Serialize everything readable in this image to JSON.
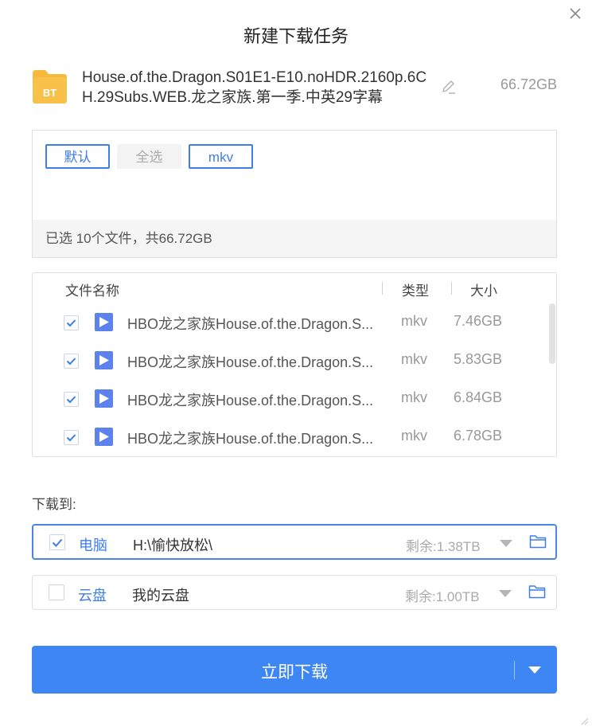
{
  "dialog": {
    "title": "新建下载任务",
    "close_icon": "close-icon"
  },
  "torrent": {
    "icon_label": "BT",
    "name": "House.of.the.Dragon.S01E1-E10.noHDR.2160p.6CH.29Subs.WEB.龙之家族.第一季.中英29字幕",
    "size": "66.72GB",
    "icon_color": "#f6b93b"
  },
  "filters": {
    "buttons": [
      {
        "label": "默认",
        "active": true
      },
      {
        "label": "全选",
        "active": false
      },
      {
        "label": "mkv",
        "active": true
      }
    ],
    "summary": "已选 10个文件，共66.72GB"
  },
  "file_list": {
    "headers": {
      "name": "文件名称",
      "type": "类型",
      "size": "大小"
    },
    "rows": [
      {
        "name": "HBO龙之家族House.of.the.Dragon.S...",
        "type": "mkv",
        "size": "7.46GB",
        "checked": true
      },
      {
        "name": "HBO龙之家族House.of.the.Dragon.S...",
        "type": "mkv",
        "size": "5.83GB",
        "checked": true
      },
      {
        "name": "HBO龙之家族House.of.the.Dragon.S...",
        "type": "mkv",
        "size": "6.84GB",
        "checked": true
      },
      {
        "name": "HBO龙之家族House.of.the.Dragon.S...",
        "type": "mkv",
        "size": "6.78GB",
        "checked": true
      }
    ]
  },
  "download_to": {
    "label": "下载到:",
    "targets": [
      {
        "label": "电脑",
        "path": "H:\\愉快放松\\",
        "free": "剩余:1.38TB",
        "checked": true
      },
      {
        "label": "云盘",
        "path": "我的云盘",
        "free": "剩余:1.00TB",
        "checked": false
      }
    ]
  },
  "actions": {
    "download_label": "立即下载"
  },
  "colors": {
    "accent": "#3e86f4",
    "link": "#3f7ee8",
    "play_icon_bg": "#5b82ed"
  }
}
